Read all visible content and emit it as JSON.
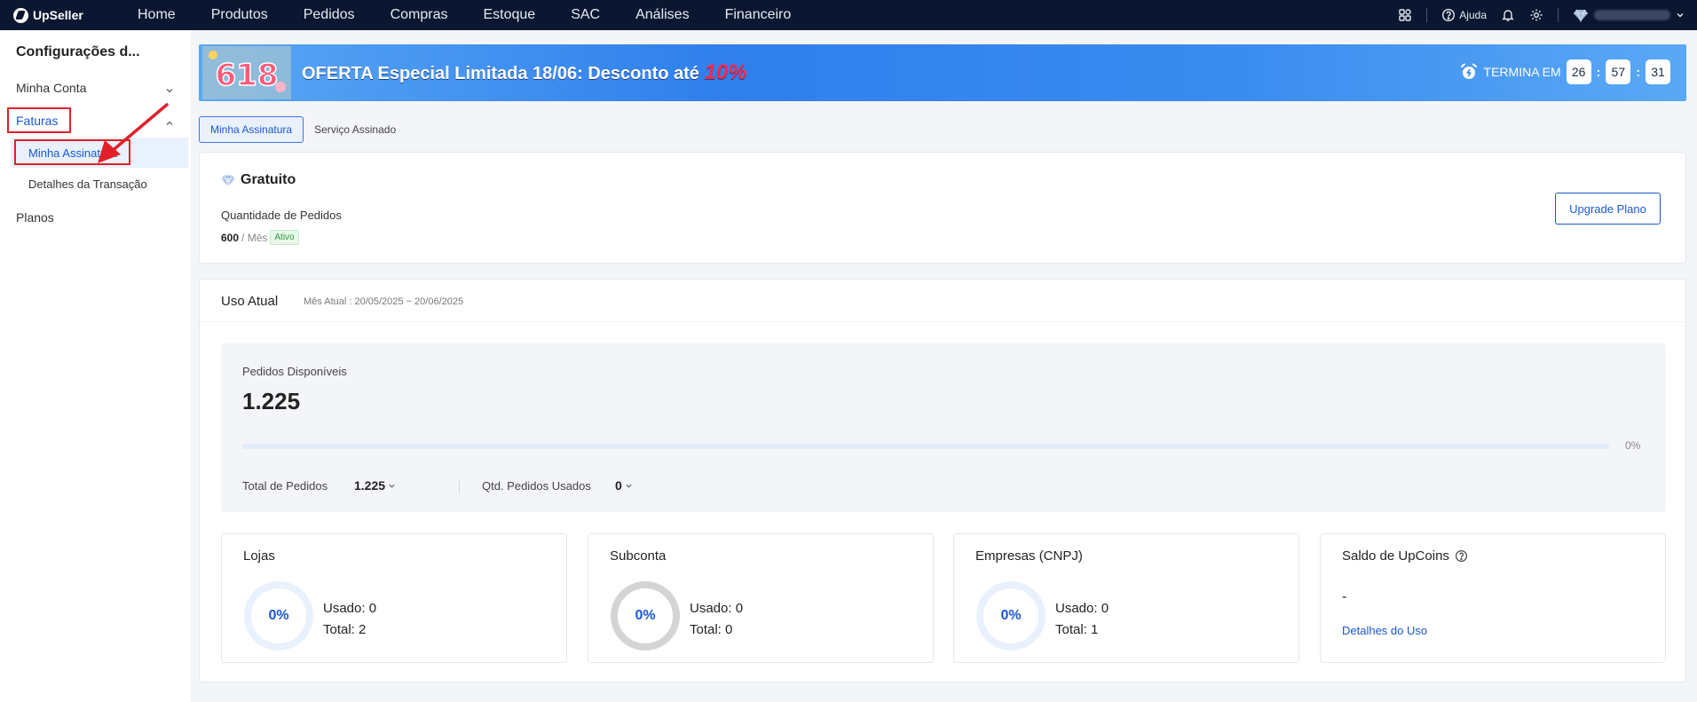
{
  "app": {
    "logo_text": "UpSeller"
  },
  "nav": {
    "items": [
      {
        "label": "Home"
      },
      {
        "label": "Produtos"
      },
      {
        "label": "Pedidos"
      },
      {
        "label": "Compras"
      },
      {
        "label": "Estoque"
      },
      {
        "label": "SAC"
      },
      {
        "label": "Análises"
      },
      {
        "label": "Financeiro"
      }
    ],
    "help_label": "Ajuda"
  },
  "sidebar": {
    "title": "Configurações d...",
    "items": {
      "minha_conta": "Minha Conta",
      "faturas": "Faturas",
      "minha_assinatura": "Minha Assinatura",
      "detalhes_transacao": "Detalhes da Transação",
      "planos": "Planos"
    }
  },
  "banner": {
    "badge": "618",
    "text": "OFERTA Especial Limitada 18/06: Desconto até ",
    "highlight": "10%",
    "ends_label": "TERMINA EM",
    "hours": "26",
    "minutes": "57",
    "seconds": "31"
  },
  "tabs": [
    {
      "label": "Minha Assinatura",
      "active": true
    },
    {
      "label": "Serviço Assinado",
      "active": false
    }
  ],
  "plan": {
    "name": "Gratuito",
    "orders_label": "Quantidade de Pedidos",
    "orders_value": "600",
    "orders_unit": "/ Mês",
    "status": "Ativo",
    "upgrade_label": "Upgrade Plano"
  },
  "usage": {
    "title": "Uso Atual",
    "period": "Mês Atual : 20/05/2025 ~ 20/06/2025",
    "available_label": "Pedidos Disponíveis",
    "available_value": "1.225",
    "progress_percent": 0,
    "progress_label": "0%",
    "total_label": "Total de Pedidos",
    "total_value": "1.225",
    "used_label": "Qtd. Pedidos Usados",
    "used_value": "0"
  },
  "cards": {
    "lojas": {
      "title": "Lojas",
      "percent": "0%",
      "used": "Usado: 0",
      "total": "Total: 2"
    },
    "subconta": {
      "title": "Subconta",
      "percent": "0%",
      "used": "Usado: 0",
      "total": "Total: 0"
    },
    "empresas": {
      "title": "Empresas (CNPJ)",
      "percent": "0%",
      "used": "Usado: 0",
      "total": "Total: 1"
    },
    "upcoins": {
      "title": "Saldo de UpCoins",
      "value": "-",
      "link": "Detalhes do Uso"
    }
  },
  "colors": {
    "nav_bg": "#0b1730",
    "accent": "#1a58d0",
    "annotation": "#e1202a",
    "active_badge": "#2e9a3e"
  },
  "icons": [
    "apps-icon",
    "help-circle-icon",
    "bell-icon",
    "gear-icon",
    "diamond-icon",
    "chevron-down-icon",
    "chevron-up-icon",
    "alarm-clock-icon",
    "question-icon"
  ]
}
